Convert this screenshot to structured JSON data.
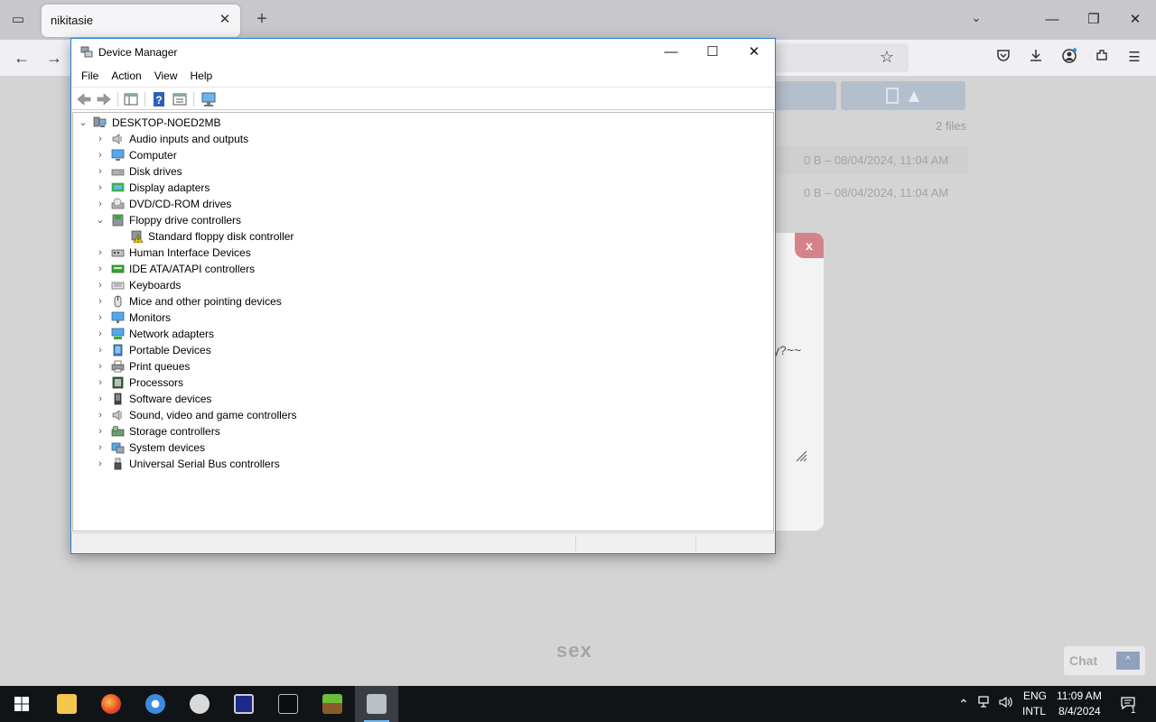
{
  "browser": {
    "tab_title": "nikitasie",
    "tab_close": "✕",
    "new_tab": "+",
    "list_all": "⌄",
    "win_min": "—",
    "win_restore": "❐",
    "win_close": "✕",
    "back": "←",
    "forward": "→",
    "star": "☆",
    "toolbar_icons": [
      "pocket-icon",
      "download-icon",
      "account-icon",
      "extensions-icon",
      "menu-icon"
    ]
  },
  "page": {
    "files_count": "2 files",
    "file_rows": [
      "0 B – 08/04/2024, 11:04 AM",
      "0 B – 08/04/2024, 11:04 AM"
    ],
    "modal_close": "x",
    "modal_text": "y?~~",
    "footer_word": "sex",
    "chat_label": "Chat",
    "chat_btn": "^"
  },
  "device_manager": {
    "title": "Device Manager",
    "controls": {
      "minimize": "—",
      "maximize": "☐",
      "close": "✕"
    },
    "menu": [
      "File",
      "Action",
      "View",
      "Help"
    ],
    "root": "DESKTOP-NOED2MB",
    "categories": [
      {
        "label": "Audio inputs and outputs",
        "icon": "speaker-icon",
        "expanded": false
      },
      {
        "label": "Computer",
        "icon": "computer-icon",
        "expanded": false
      },
      {
        "label": "Disk drives",
        "icon": "disk-drive-icon",
        "expanded": false
      },
      {
        "label": "Display adapters",
        "icon": "display-adapter-icon",
        "expanded": false
      },
      {
        "label": "DVD/CD-ROM drives",
        "icon": "dvd-drive-icon",
        "expanded": false
      },
      {
        "label": "Floppy drive controllers",
        "icon": "floppy-controller-icon",
        "expanded": true,
        "children": [
          {
            "label": "Standard floppy disk controller",
            "icon": "warning-device-icon"
          }
        ]
      },
      {
        "label": "Human Interface Devices",
        "icon": "hid-icon",
        "expanded": false
      },
      {
        "label": "IDE ATA/ATAPI controllers",
        "icon": "ide-controller-icon",
        "expanded": false
      },
      {
        "label": "Keyboards",
        "icon": "keyboard-icon",
        "expanded": false
      },
      {
        "label": "Mice and other pointing devices",
        "icon": "mouse-icon",
        "expanded": false
      },
      {
        "label": "Monitors",
        "icon": "monitor-icon",
        "expanded": false
      },
      {
        "label": "Network adapters",
        "icon": "network-adapter-icon",
        "expanded": false
      },
      {
        "label": "Portable Devices",
        "icon": "portable-device-icon",
        "expanded": false
      },
      {
        "label": "Print queues",
        "icon": "printer-icon",
        "expanded": false
      },
      {
        "label": "Processors",
        "icon": "processor-icon",
        "expanded": false
      },
      {
        "label": "Software devices",
        "icon": "software-device-icon",
        "expanded": false
      },
      {
        "label": "Sound, video and game controllers",
        "icon": "sound-icon",
        "expanded": false
      },
      {
        "label": "Storage controllers",
        "icon": "storage-controller-icon",
        "expanded": false
      },
      {
        "label": "System devices",
        "icon": "system-device-icon",
        "expanded": false
      },
      {
        "label": "Universal Serial Bus controllers",
        "icon": "usb-icon",
        "expanded": false
      }
    ]
  },
  "taskbar": {
    "apps": [
      "start-icon",
      "file-explorer-icon",
      "firefox-icon",
      "media-player-icon",
      "film-app-icon",
      "display-app-icon",
      "terminal-icon",
      "minecraft-icon",
      "device-manager-icon"
    ],
    "language": "ENG",
    "layout": "INTL",
    "time": "11:09 AM",
    "date": "8/4/2024",
    "notification_count": "1"
  }
}
